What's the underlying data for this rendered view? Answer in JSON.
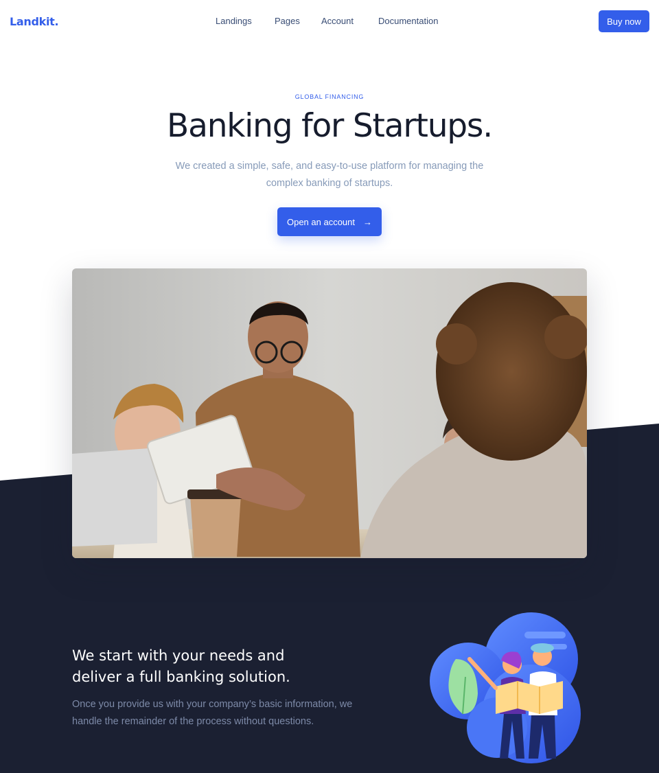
{
  "brand": "Landkit.",
  "nav": {
    "links": [
      "Landings",
      "Pages",
      "Account",
      "Documentation"
    ],
    "buy_label": "Buy now"
  },
  "hero": {
    "eyebrow": "GLOBAL FINANCING",
    "title": "Banking for Startups.",
    "lead": "We created a simple, safe, and easy-to-use platform for managing the complex banking of startups.",
    "cta_label": "Open an account",
    "cta_icon": "arrow-right-icon"
  },
  "feature": {
    "title": "We start with your needs and deliver a full banking solution.",
    "text": "Once you provide us with your company’s basic information, we handle the remainder of the process without questions."
  },
  "colors": {
    "primary": "#335eea",
    "dark": "#1b2032",
    "text_muted": "#869ab8",
    "heading": "#161c2d"
  }
}
